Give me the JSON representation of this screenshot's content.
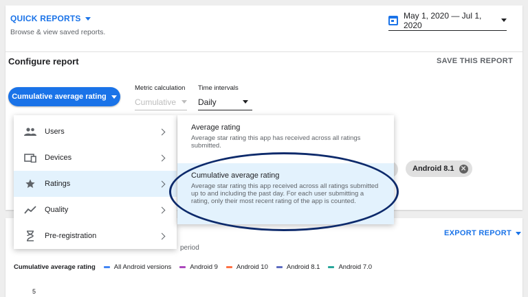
{
  "header": {
    "quick_reports": "QUICK REPORTS",
    "subtitle": "Browse & view saved reports.",
    "date_range": "May 1, 2020 — Jul 1, 2020"
  },
  "configure": {
    "title": "Configure report",
    "save_label": "SAVE THIS REPORT",
    "metric_button": "Cumulative average rating",
    "metric_calc_label": "Metric calculation",
    "metric_calc_value": "Cumulative",
    "time_intervals_label": "Time intervals",
    "time_intervals_value": "Daily"
  },
  "chips": [
    {
      "label": "Android 8.1"
    }
  ],
  "menu": {
    "items": [
      {
        "label": "Users",
        "icon": "users-icon"
      },
      {
        "label": "Devices",
        "icon": "devices-icon"
      },
      {
        "label": "Ratings",
        "icon": "star-icon",
        "selected": true
      },
      {
        "label": "Quality",
        "icon": "trending-icon"
      },
      {
        "label": "Pre-registration",
        "icon": "hourglass-icon"
      }
    ]
  },
  "submenu": {
    "items": [
      {
        "title": "Average rating",
        "description": "Average star rating this app has received across all ratings submitted."
      },
      {
        "title": "Cumulative average rating",
        "description": "Average star rating this app received across all ratings submitted up to and including the past day. For each user submitting a rating, only their most recent rating of the app is counted.",
        "selected": true
      }
    ]
  },
  "bottom": {
    "export_label": "EXPORT REPORT",
    "partial_text": "period",
    "legend_title": "Cumulative average rating",
    "legend": [
      {
        "label": "All Android versions",
        "color": "#4285f4"
      },
      {
        "label": "Android 9",
        "color": "#ab47bc"
      },
      {
        "label": "Android 10",
        "color": "#ff7043"
      },
      {
        "label": "Android 8.1",
        "color": "#5c6bc0"
      },
      {
        "label": "Android 7.0",
        "color": "#26a69a"
      }
    ],
    "y_tick": "5"
  },
  "colors": {
    "accent": "#1a73e8",
    "highlight_ring": "#0d2a6b",
    "selected_bg": "#e3f2fd"
  }
}
